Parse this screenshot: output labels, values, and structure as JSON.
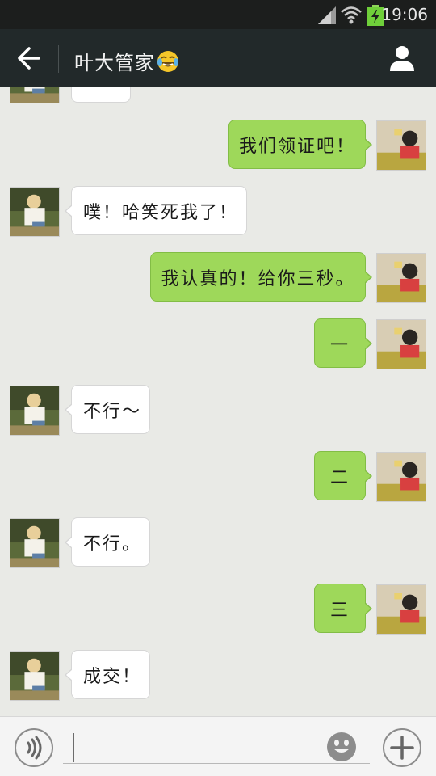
{
  "status_bar": {
    "time": "19:06",
    "battery_color": "#6fcf3a"
  },
  "header": {
    "title": "叶大管家",
    "title_emoji": "face-with-tears-of-joy-icon",
    "back_icon": "back-arrow-icon",
    "profile_icon": "person-icon"
  },
  "colors": {
    "sent_bubble": "#9ed85a",
    "received_bubble": "#ffffff",
    "chat_background": "#e9eae6",
    "title_bar": "#22292a"
  },
  "messages": [
    {
      "from": "contact",
      "text": ""
    },
    {
      "from": "me",
      "text": "我们领证吧！"
    },
    {
      "from": "contact",
      "text": "噗！哈笑死我了！"
    },
    {
      "from": "me",
      "text": "我认真的！给你三秒。"
    },
    {
      "from": "me",
      "text": "一"
    },
    {
      "from": "contact",
      "text": "不行～"
    },
    {
      "from": "me",
      "text": "二"
    },
    {
      "from": "contact",
      "text": "不行。"
    },
    {
      "from": "me",
      "text": "三"
    },
    {
      "from": "contact",
      "text": "成交！"
    }
  ],
  "input_bar": {
    "placeholder": "",
    "voice_icon": "voice-icon",
    "emoji_icon": "smiley-icon",
    "plus_icon": "plus-icon"
  }
}
